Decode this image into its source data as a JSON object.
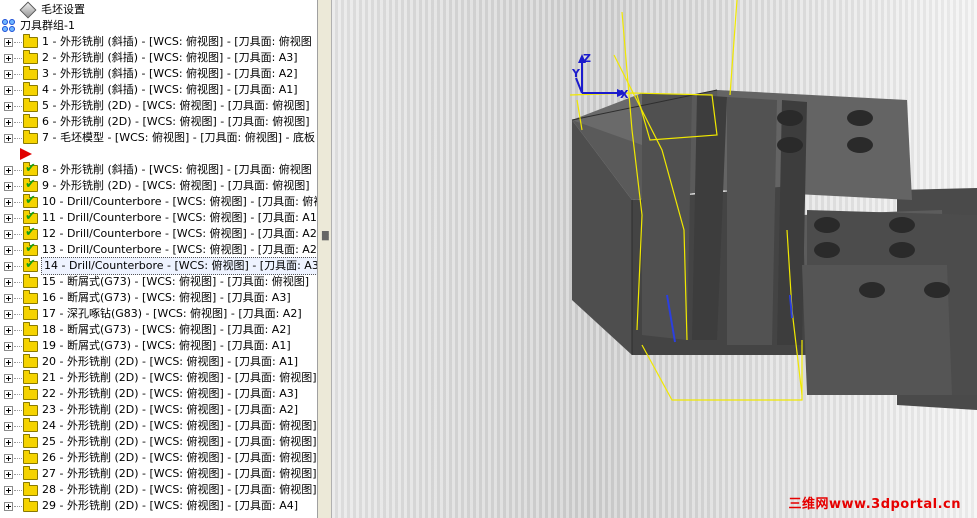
{
  "tree": {
    "stock_setup": "毛坯设置",
    "group": "刀具群组-1",
    "ops": [
      {
        "label": "1 - 外形铣削 (斜插) - [WCS: 俯视图] - [刀具面: 俯视图",
        "check": false
      },
      {
        "label": "2 - 外形铣削 (斜插) - [WCS: 俯视图] - [刀具面: A3]",
        "check": false
      },
      {
        "label": "3 - 外形铣削 (斜插) - [WCS: 俯视图] - [刀具面: A2]",
        "check": false
      },
      {
        "label": "4 - 外形铣削 (斜插) - [WCS: 俯视图] - [刀具面: A1]",
        "check": false
      },
      {
        "label": "5 - 外形铣削 (2D) - [WCS: 俯视图] - [刀具面: 俯视图]",
        "check": false
      },
      {
        "label": "6 - 外形铣削 (2D) - [WCS: 俯视图] - [刀具面: 俯视图]",
        "check": false
      },
      {
        "label": "7 - 毛坯模型 - [WCS: 俯视图] - [刀具面: 俯视图] - 底板",
        "check": false
      },
      {
        "label": "8 - 外形铣削 (斜插) - [WCS: 俯视图] - [刀具面: 俯视图",
        "check": true
      },
      {
        "label": "9 - 外形铣削 (2D) - [WCS: 俯视图] - [刀具面: 俯视图]",
        "check": true
      },
      {
        "label": "10 - Drill/Counterbore - [WCS: 俯视图] - [刀具面: 俯视图",
        "check": true
      },
      {
        "label": "11 - Drill/Counterbore - [WCS: 俯视图] - [刀具面: A1]",
        "check": true
      },
      {
        "label": "12 - Drill/Counterbore - [WCS: 俯视图] - [刀具面: A2]",
        "check": true
      },
      {
        "label": "13 - Drill/Counterbore - [WCS: 俯视图] - [刀具面: A2]",
        "check": true
      },
      {
        "label": "14 - Drill/Counterbore - [WCS: 俯视图] - [刀具面: A3]",
        "check": true
      },
      {
        "label": "15 - 断屑式(G73) - [WCS: 俯视图] - [刀具面: 俯视图]",
        "check": false
      },
      {
        "label": "16 - 断屑式(G73) - [WCS: 俯视图] - [刀具面: A3]",
        "check": false
      },
      {
        "label": "17 - 深孔啄钻(G83) - [WCS: 俯视图] - [刀具面: A2]",
        "check": false
      },
      {
        "label": "18 - 断屑式(G73) - [WCS: 俯视图] - [刀具面: A2]",
        "check": false
      },
      {
        "label": "19 - 断屑式(G73) - [WCS: 俯视图] - [刀具面: A1]",
        "check": false
      },
      {
        "label": "20 - 外形铣削 (2D) - [WCS: 俯视图] - [刀具面: A1]",
        "check": false
      },
      {
        "label": "21 - 外形铣削 (2D) - [WCS: 俯视图] - [刀具面: 俯视图]",
        "check": false
      },
      {
        "label": "22 - 外形铣削 (2D) - [WCS: 俯视图] - [刀具面: A3]",
        "check": false
      },
      {
        "label": "23 - 外形铣削 (2D) - [WCS: 俯视图] - [刀具面: A2]",
        "check": false
      },
      {
        "label": "24 - 外形铣削 (2D) - [WCS: 俯视图] - [刀具面: 俯视图]",
        "check": false
      },
      {
        "label": "25 - 外形铣削 (2D) - [WCS: 俯视图] - [刀具面: 俯视图]",
        "check": false
      },
      {
        "label": "26 - 外形铣削 (2D) - [WCS: 俯视图] - [刀具面: 俯视图]",
        "check": false
      },
      {
        "label": "27 - 外形铣削 (2D) - [WCS: 俯视图] - [刀具面: 俯视图]",
        "check": false
      },
      {
        "label": "28 - 外形铣削 (2D) - [WCS: 俯视图] - [刀具面: 俯视图]",
        "check": false
      },
      {
        "label": "29 - 外形铣削 (2D) - [WCS: 俯视图] - [刀具面: A4]",
        "check": false
      }
    ],
    "selected_index": 13,
    "marker_after_index": 6,
    "stock_icon": "stock-diamond-icon",
    "group_icon": "toolpath-group-icon",
    "folder_icon": "operation-folder-icon",
    "check_icon": "checkmark-icon",
    "marker_icon": "insert-arrow-icon"
  },
  "viewport": {
    "axis_z": "Z",
    "axis_y": "Y",
    "axis_x": "X",
    "watermark": "三维网www.3dportal.cn",
    "colors": {
      "part": "#555555",
      "toolpath": "#f0e800",
      "axis": "#1b1bcc",
      "watermark": "#e60000"
    }
  }
}
